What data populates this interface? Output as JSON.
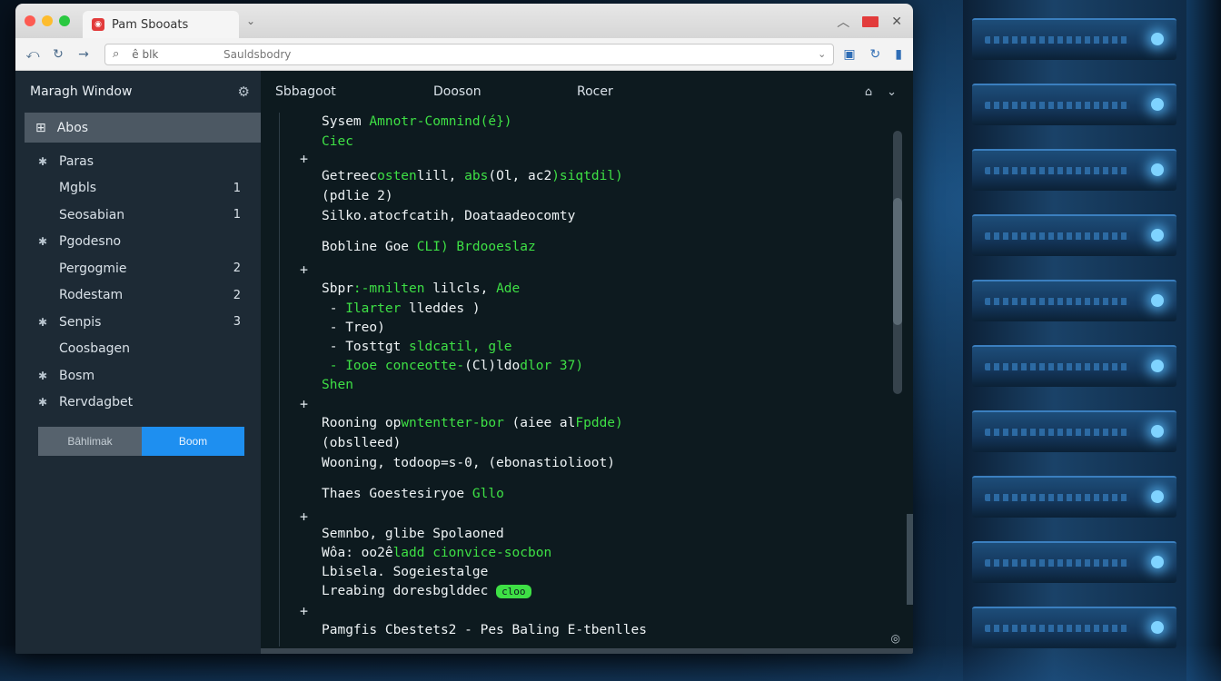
{
  "window": {
    "tab_title": "Pam Sbooats"
  },
  "address": {
    "search_text": "ê blk",
    "url": "Sauldsbodry"
  },
  "sidebar": {
    "title": "Maragh Window",
    "active_item": "Abos",
    "items": [
      {
        "label": "Paras",
        "icon": "star-icon",
        "count": ""
      },
      {
        "label": "Mgbls",
        "icon": "",
        "count": "1"
      },
      {
        "label": "Seosabian",
        "icon": "",
        "count": "1"
      },
      {
        "label": "Pgodesno",
        "icon": "star-icon",
        "count": ""
      },
      {
        "label": "Pergogmie",
        "icon": "",
        "count": "2"
      },
      {
        "label": "Rodestam",
        "icon": "",
        "count": "2"
      },
      {
        "label": "Senpis",
        "icon": "star-icon",
        "count": "3"
      },
      {
        "label": "Coosbagen",
        "icon": "",
        "count": ""
      },
      {
        "label": "Bosm",
        "icon": "star-icon",
        "count": ""
      },
      {
        "label": "Rervdagbet",
        "icon": "star-icon",
        "count": ""
      }
    ],
    "btn_secondary": "Bâhlimak",
    "btn_primary": "Boom"
  },
  "main": {
    "tabs": [
      "Sbbagoot",
      "Dooson",
      "Rocer"
    ]
  },
  "terminal": {
    "l1a": "Sysem ",
    "l1b": "Amnotr-Comnind(é})",
    "l2": "Ciec",
    "l3a": "Getreec",
    "l3b": "osten",
    "l3c": "lill, ",
    "l3d": "abs",
    "l3e": "(Ol, ac2",
    "l3f": ")siqtdil)",
    "l4": "(pdlie 2)",
    "l5": "Silko.atocfcatih, Doataadeocomty",
    "l6a": "Bobline Goe ",
    "l6b": "CLI) Brdooeslaz",
    "l7a": "Sbpr",
    "l7b": ":-mnilten ",
    "l7c": "lilcls, ",
    "l7d": "Ade",
    "l8a": " - ",
    "l8b": "Ilarter",
    "l8c": " lleddes )",
    "l9": " - Treo)",
    "l10a": " - Tosttgt ",
    "l10b": "sldcatil,",
    "l10c": " ",
    "l10d": "gle",
    "l11a": " - Iooe conceotte-",
    "l11b": "(Cl)ldo",
    "l11c": "dlor 37)",
    "l12": "Shen",
    "l13a": "Rooning op",
    "l13b": "wntentter-bor",
    "l13c": " (aiee al",
    "l13d": "Fpdde)",
    "l14": "(obslleed)",
    "l15": "Wooning, todoop=s-0, (ebonastiolioot)",
    "l16a": "Thaes Goestesiryoe ",
    "l16b": "Gllo",
    "l17": "Semnbo, glibe Spolaoned",
    "l18a": "Wôa: ",
    "l18b": "oo2ê",
    "l18c": "ladd cionvice-socbon",
    "l19": "Lbisela. Sogeiestalge",
    "l20a": "Lreabing",
    "l20b": " doresbglddec ",
    "l20c": "cloo",
    "l21": "Pamgfis Cbestets2 - Pes Baling E-tbenlles"
  }
}
